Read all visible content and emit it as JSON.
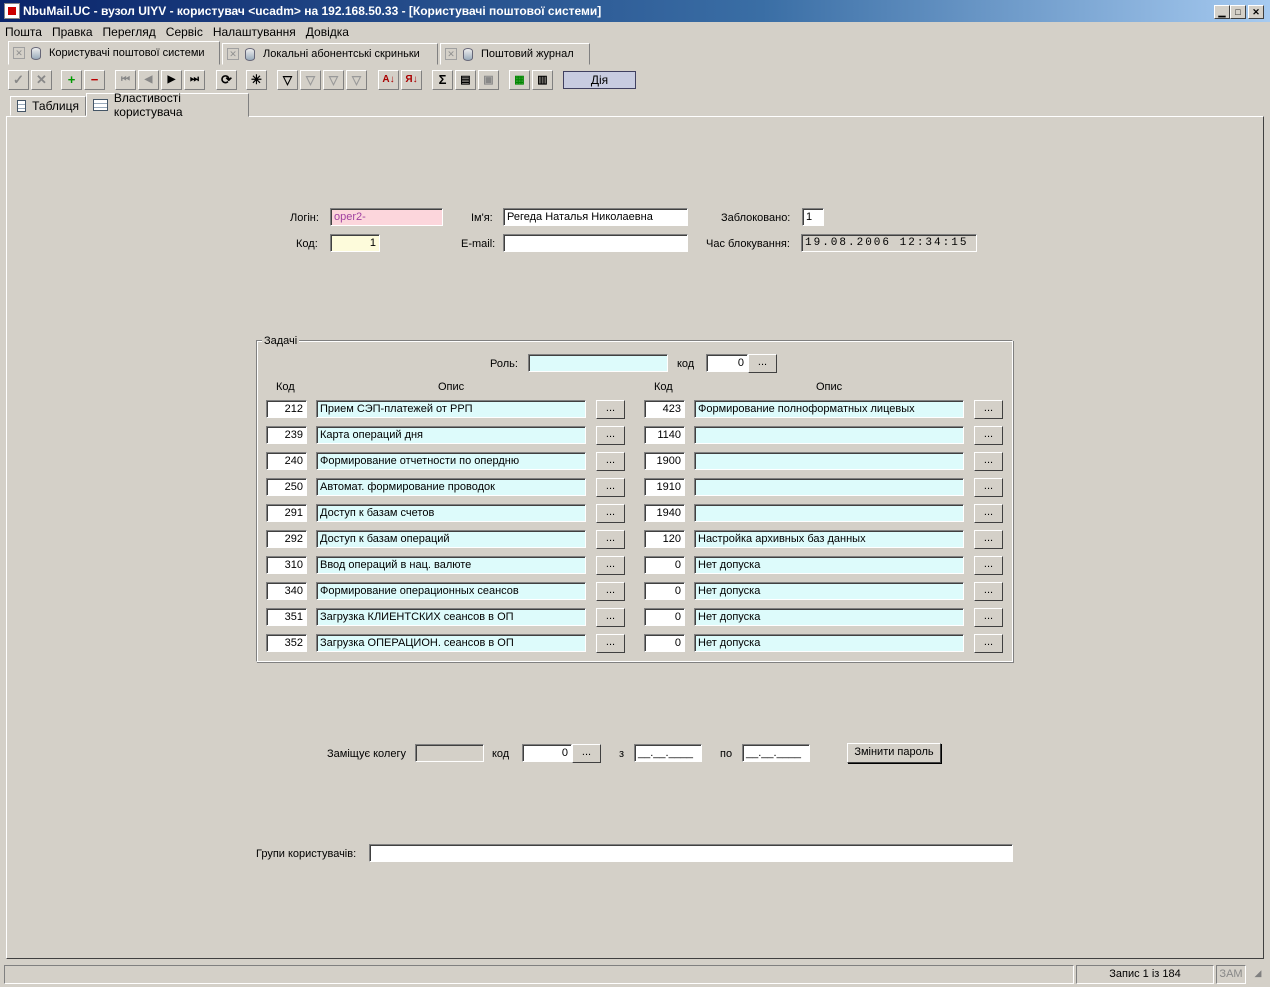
{
  "window": {
    "title": "NbuMail.UC - вузол UIYV - користувач <ucadm> на 192.168.50.33 - [Користувачі поштової системи]"
  },
  "menu": [
    "Пошта",
    "Правка",
    "Перегляд",
    "Сервіс",
    "Налаштування",
    "Довідка"
  ],
  "doc_tabs": [
    "Користувачі поштової системи",
    "Локальні абонентські скриньки",
    "Поштовий журнал"
  ],
  "toolbar": {
    "action_label": "Дія"
  },
  "sub_tabs": [
    "Таблиця",
    "Властивості користувача"
  ],
  "user": {
    "login_label": "Логін:",
    "login": "oper2-",
    "code_label": "Код:",
    "code": "1",
    "name_label": "Ім'я:",
    "name": "Регеда Наталья Николаевна",
    "email_label": "E-mail:",
    "email": "",
    "blocked_label": "Заблоковано:",
    "blocked": "1",
    "block_time_label": "Час блокування:",
    "block_time": "19.08.2006 12:34:15"
  },
  "tasks": {
    "title": "Задачі",
    "role_label": "Роль:",
    "role": "",
    "role_code_label": "код",
    "role_code": "0",
    "col_code": "Код",
    "col_desc": "Опис",
    "dots": "...",
    "left": [
      {
        "code": "212",
        "desc": "Прием    СЭП-платежей от РРП"
      },
      {
        "code": "239",
        "desc": "Карта операций дня"
      },
      {
        "code": "240",
        "desc": "Формирование отчетности по опердню"
      },
      {
        "code": "250",
        "desc": "Автомат. формирование проводок"
      },
      {
        "code": "291",
        "desc": "Доступ к базам счетов"
      },
      {
        "code": "292",
        "desc": "Доступ к базам операций"
      },
      {
        "code": "310",
        "desc": "Ввод операций в нац. валюте"
      },
      {
        "code": "340",
        "desc": "Формирование операционных сеансов"
      },
      {
        "code": "351",
        "desc": "Загрузка КЛИЕНТСКИХ сеансов в ОП"
      },
      {
        "code": "352",
        "desc": "Загрузка ОПЕРАЦИОН. сеансов в ОП"
      }
    ],
    "right": [
      {
        "code": "423",
        "desc": "Формирование полноформатных лицевых"
      },
      {
        "code": "1140",
        "desc": ""
      },
      {
        "code": "1900",
        "desc": ""
      },
      {
        "code": "1910",
        "desc": ""
      },
      {
        "code": "1940",
        "desc": ""
      },
      {
        "code": "120",
        "desc": "Настройка архивных баз данных"
      },
      {
        "code": "0",
        "desc": "Нет допуска"
      },
      {
        "code": "0",
        "desc": "Нет допуска"
      },
      {
        "code": "0",
        "desc": "Нет допуска"
      },
      {
        "code": "0",
        "desc": "Нет допуска"
      }
    ]
  },
  "substitute": {
    "label": "Заміщує колегу",
    "value": "",
    "code_label": "код",
    "code": "0",
    "from_label": "з",
    "from": "__.__.____",
    "to_label": "по",
    "to": "__.__.____",
    "change_password": "Змінити пароль"
  },
  "groups": {
    "label": "Групи користувачів:",
    "value": ""
  },
  "status": {
    "record": "Запис 1 із 184",
    "caps": "ЗАМ"
  }
}
